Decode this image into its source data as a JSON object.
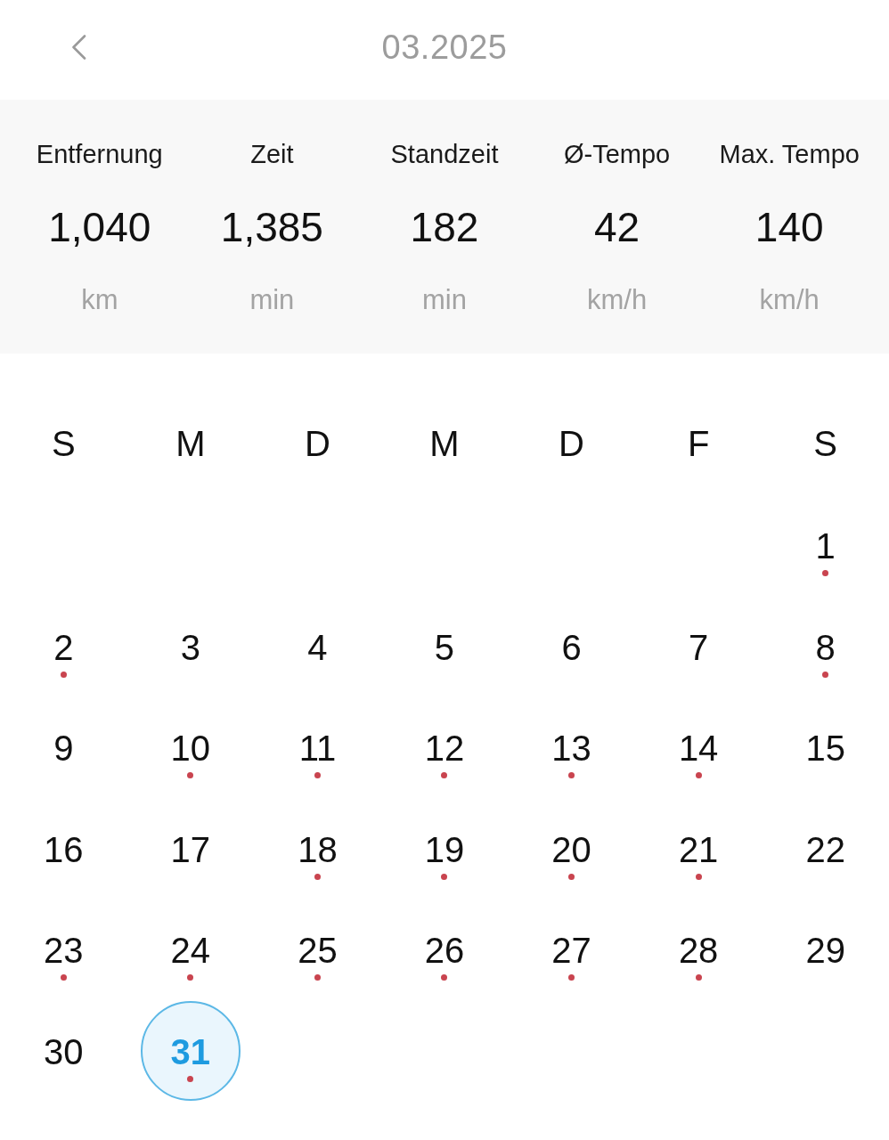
{
  "header": {
    "title": "03.2025"
  },
  "stats": [
    {
      "label": "Entfernung",
      "value": "1,040",
      "unit": "km"
    },
    {
      "label": "Zeit",
      "value": "1,385",
      "unit": "min"
    },
    {
      "label": "Standzeit",
      "value": "182",
      "unit": "min"
    },
    {
      "label": "Ø-Tempo",
      "value": "42",
      "unit": "km/h"
    },
    {
      "label": "Max. Tempo",
      "value": "140",
      "unit": "km/h"
    }
  ],
  "calendar": {
    "weekdays": [
      "S",
      "M",
      "D",
      "M",
      "D",
      "F",
      "S"
    ],
    "weeks": [
      [
        {
          "day": "1",
          "has_entry": true,
          "selected": false
        }
      ],
      [
        {
          "day": "2",
          "has_entry": true,
          "selected": false
        },
        {
          "day": "3",
          "has_entry": false,
          "selected": false
        },
        {
          "day": "4",
          "has_entry": false,
          "selected": false
        },
        {
          "day": "5",
          "has_entry": false,
          "selected": false
        },
        {
          "day": "6",
          "has_entry": false,
          "selected": false
        },
        {
          "day": "7",
          "has_entry": false,
          "selected": false
        },
        {
          "day": "8",
          "has_entry": true,
          "selected": false
        }
      ],
      [
        {
          "day": "9",
          "has_entry": false,
          "selected": false
        },
        {
          "day": "10",
          "has_entry": true,
          "selected": false
        },
        {
          "day": "11",
          "has_entry": true,
          "selected": false
        },
        {
          "day": "12",
          "has_entry": true,
          "selected": false
        },
        {
          "day": "13",
          "has_entry": true,
          "selected": false
        },
        {
          "day": "14",
          "has_entry": true,
          "selected": false
        },
        {
          "day": "15",
          "has_entry": false,
          "selected": false
        }
      ],
      [
        {
          "day": "16",
          "has_entry": false,
          "selected": false
        },
        {
          "day": "17",
          "has_entry": false,
          "selected": false
        },
        {
          "day": "18",
          "has_entry": true,
          "selected": false
        },
        {
          "day": "19",
          "has_entry": true,
          "selected": false
        },
        {
          "day": "20",
          "has_entry": true,
          "selected": false
        },
        {
          "day": "21",
          "has_entry": true,
          "selected": false
        },
        {
          "day": "22",
          "has_entry": false,
          "selected": false
        }
      ],
      [
        {
          "day": "23",
          "has_entry": true,
          "selected": false
        },
        {
          "day": "24",
          "has_entry": true,
          "selected": false
        },
        {
          "day": "25",
          "has_entry": true,
          "selected": false
        },
        {
          "day": "26",
          "has_entry": true,
          "selected": false
        },
        {
          "day": "27",
          "has_entry": true,
          "selected": false
        },
        {
          "day": "28",
          "has_entry": true,
          "selected": false
        },
        {
          "day": "29",
          "has_entry": false,
          "selected": false
        }
      ],
      [
        {
          "day": "30",
          "has_entry": false,
          "selected": false
        },
        {
          "day": "31",
          "has_entry": true,
          "selected": true
        }
      ]
    ]
  }
}
